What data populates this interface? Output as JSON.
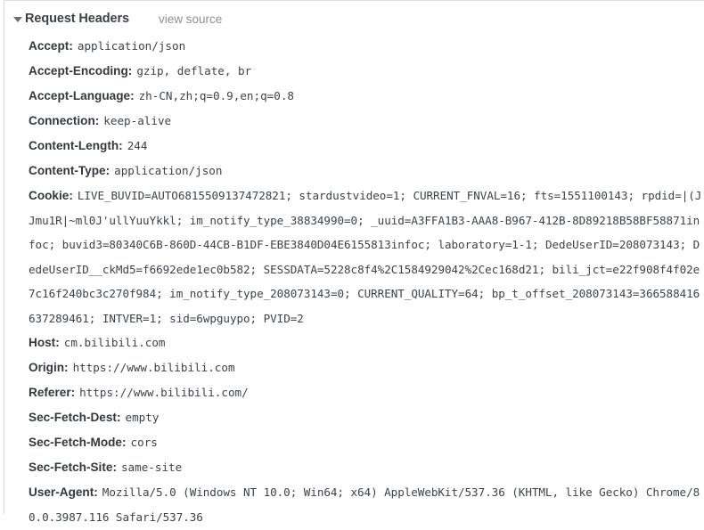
{
  "section": {
    "title": "Request Headers",
    "view_source_label": "view source",
    "disclosure_icon": "triangle-down-icon",
    "expanded": true
  },
  "colors": {
    "background": "#ffffff",
    "header_name": "#33383d",
    "header_value": "#3d4349",
    "section_title": "#3b4248",
    "view_source": "#8e8e8e",
    "border": "#e0e0e0"
  },
  "headers": [
    {
      "name": "Accept",
      "value": "application/json"
    },
    {
      "name": "Accept-Encoding",
      "value": "gzip, deflate, br"
    },
    {
      "name": "Accept-Language",
      "value": "zh-CN,zh;q=0.9,en;q=0.8"
    },
    {
      "name": "Connection",
      "value": "keep-alive"
    },
    {
      "name": "Content-Length",
      "value": "244"
    },
    {
      "name": "Content-Type",
      "value": "application/json"
    },
    {
      "name": "Cookie",
      "value": "LIVE_BUVID=AUTO6815509137472821; stardustvideo=1; CURRENT_FNVAL=16; fts=1551100143; rpdid=|(JJmu1R|~ml0J'ullYuuYkkl; im_notify_type_38834990=0; _uuid=A3FFA1B3-AAA8-B967-412B-8D89218B58BF58871infoc; buvid3=80340C6B-860D-44CB-B1DF-EBE3840D04E6155813infoc; laboratory=1-1; DedeUserID=208073143; DedeUserID__ckMd5=f6692ede1ec0b582; SESSDATA=5228c8f4%2C1584929042%2Cec168d21; bili_jct=e22f908f4f02e7c16f240bc3c270f984; im_notify_type_208073143=0; CURRENT_QUALITY=64; bp_t_offset_208073143=366588416637289461; INTVER=1; sid=6wpguypo; PVID=2"
    },
    {
      "name": "Host",
      "value": "cm.bilibili.com"
    },
    {
      "name": "Origin",
      "value": "https://www.bilibili.com"
    },
    {
      "name": "Referer",
      "value": "https://www.bilibili.com/"
    },
    {
      "name": "Sec-Fetch-Dest",
      "value": "empty"
    },
    {
      "name": "Sec-Fetch-Mode",
      "value": "cors"
    },
    {
      "name": "Sec-Fetch-Site",
      "value": "same-site"
    },
    {
      "name": "User-Agent",
      "value": "Mozilla/5.0 (Windows NT 10.0; Win64; x64) AppleWebKit/537.36 (KHTML, like Gecko) Chrome/80.0.3987.116 Safari/537.36"
    }
  ]
}
